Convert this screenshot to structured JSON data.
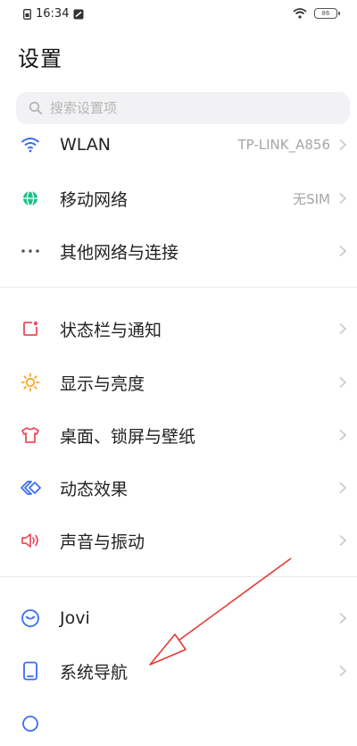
{
  "status_bar": {
    "time": "16:34",
    "battery": "86"
  },
  "page": {
    "title": "设置"
  },
  "search": {
    "placeholder": "搜索设置项"
  },
  "network": [
    {
      "label": "WLAN",
      "value": "TP-LINK_A856",
      "icon": "wifi-icon"
    },
    {
      "label": "移动网络",
      "value": "无SIM",
      "icon": "globe-icon"
    },
    {
      "label": "其他网络与连接",
      "value": "",
      "icon": "more-icon"
    }
  ],
  "display": [
    {
      "label": "状态栏与通知",
      "icon": "status-bar-icon"
    },
    {
      "label": "显示与亮度",
      "icon": "sun-icon"
    },
    {
      "label": "桌面、锁屏与壁纸",
      "icon": "shirt-icon"
    },
    {
      "label": "动态效果",
      "icon": "diamond-icon"
    },
    {
      "label": "声音与振动",
      "icon": "speaker-icon"
    }
  ],
  "system": [
    {
      "label": "Jovi",
      "icon": "jovi-icon"
    },
    {
      "label": "系统导航",
      "icon": "phone-icon"
    }
  ],
  "colors": {
    "accent_blue": "#3b6cf6",
    "green": "#1bbf8a",
    "orange": "#f5a623",
    "red": "#ef4b5d",
    "arrow_red": "#e53935"
  }
}
